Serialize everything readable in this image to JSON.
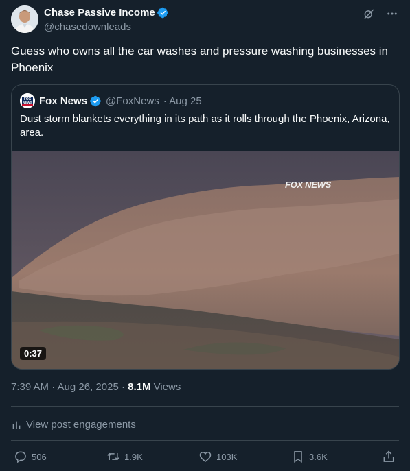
{
  "author": {
    "name": "Chase Passive Income",
    "handle": "@chasedownleads",
    "avatar_icon": "person-avatar"
  },
  "tweet": {
    "text": "Guess who owns all the car washes and pressure washing businesses in Phoenix"
  },
  "quote": {
    "name": "Fox News",
    "handle": "@FoxNews",
    "date": "· Aug 25",
    "text": "Dust storm blankets everything in its path as it rolls through the Phoenix, Arizona, area.",
    "logo_text": "FOX NEWS",
    "media": {
      "watermark": "FOX NEWS",
      "duration": "0:37"
    }
  },
  "meta": {
    "time": "7:39 AM · Aug 26, 2025 · ",
    "views_count": "8.1M",
    "views_label": " Views"
  },
  "engagements_label": "View post engagements",
  "actions": {
    "replies": "506",
    "reposts": "1.9K",
    "likes": "103K",
    "bookmarks": "3.6K"
  },
  "colors": {
    "background": "#15202b",
    "verified": "#1d9bf0",
    "muted": "#8b98a5",
    "border": "#38444d"
  }
}
